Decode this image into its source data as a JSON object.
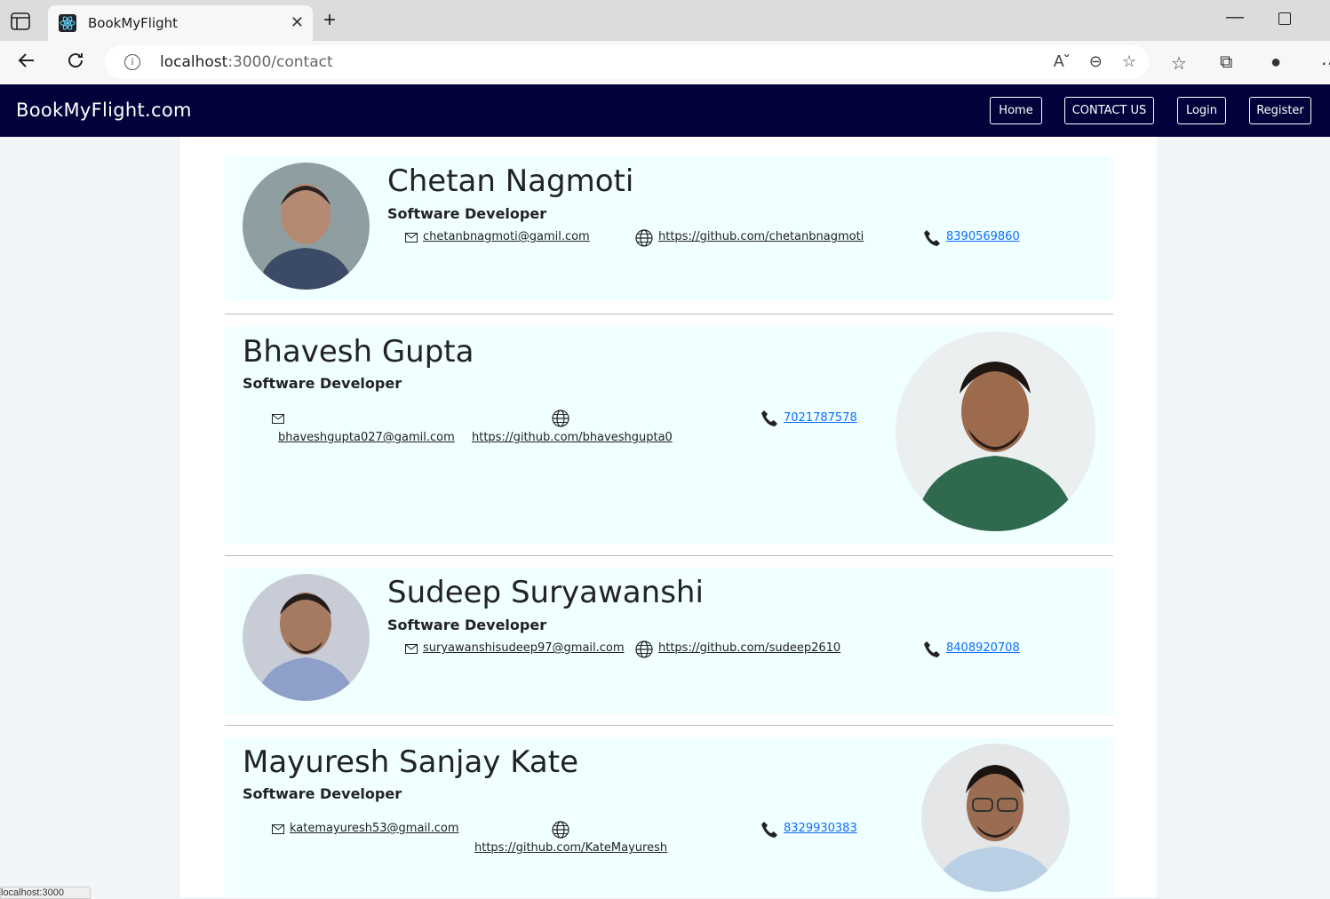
{
  "browser": {
    "tab_title": "BookMyFlight",
    "tab_close": "✕",
    "new_tab": "+",
    "url_host": "localhost",
    "url_path": ":3000/contact",
    "status_text": "localhost:3000"
  },
  "navbar": {
    "brand": "BookMyFlight.com",
    "links": [
      "Home",
      "CONTACT US",
      "Login",
      "Register"
    ]
  },
  "contacts": [
    {
      "name": "Chetan Nagmoti",
      "role": "Software Developer",
      "email": "chetanbnagmoti@gamil.com",
      "github": "https://github.com/chetanbnagmoti",
      "phone": "8390569860"
    },
    {
      "name": "Bhavesh Gupta",
      "role": "Software Developer",
      "email": "bhaveshgupta027@gamil.com",
      "github": "https://github.com/bhaveshgupta0",
      "phone": "7021787578"
    },
    {
      "name": "Sudeep Suryawanshi",
      "role": "Software Developer",
      "email": "suryawanshisudeep97@gmail.com",
      "github": "https://github.com/sudeep2610",
      "phone": "8408920708"
    },
    {
      "name": "Mayuresh Sanjay Kate",
      "role": "Software Developer",
      "email": "katemayuresh53@gmail.com",
      "github": "https://github.com/KateMayuresh",
      "phone": "8329930383"
    }
  ],
  "colors": {
    "navbar": "#02033b",
    "card": "#f0ffff",
    "phone_link": "#0d6efd"
  }
}
